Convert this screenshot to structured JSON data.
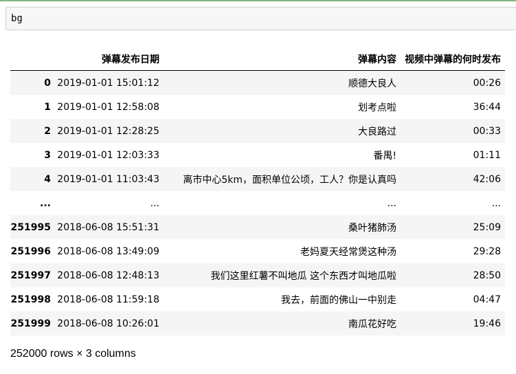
{
  "cell": {
    "code": "bg"
  },
  "table": {
    "columns": [
      "",
      "弹幕发布日期",
      "弹幕内容",
      "视频中弹幕的何时发布"
    ],
    "rows": [
      {
        "index": "0",
        "date": "2019-01-01 15:01:12",
        "content": "顺德大良人",
        "time": "00:26"
      },
      {
        "index": "1",
        "date": "2019-01-01 12:58:08",
        "content": "划考点啦",
        "time": "36:44"
      },
      {
        "index": "2",
        "date": "2019-01-01 12:28:25",
        "content": "大良路过",
        "time": "00:33"
      },
      {
        "index": "3",
        "date": "2019-01-01 12:03:33",
        "content": "番禺!",
        "time": "01:11"
      },
      {
        "index": "4",
        "date": "2019-01-01 11:03:43",
        "content": "离市中心5km，面积单位公顷，工人？你是认真吗",
        "time": "42:06"
      },
      {
        "index": "...",
        "date": "...",
        "content": "...",
        "time": "..."
      },
      {
        "index": "251995",
        "date": "2018-06-08 15:51:31",
        "content": "桑叶猪肺汤",
        "time": "25:09"
      },
      {
        "index": "251996",
        "date": "2018-06-08 13:49:09",
        "content": "老妈夏天经常煲这种汤",
        "time": "29:28"
      },
      {
        "index": "251997",
        "date": "2018-06-08 12:48:13",
        "content": "我们这里红薯不叫地瓜 这个东西才叫地瓜啦",
        "time": "28:50"
      },
      {
        "index": "251998",
        "date": "2018-06-08 11:59:18",
        "content": "我去，前面的佛山一中别走",
        "time": "04:47"
      },
      {
        "index": "251999",
        "date": "2018-06-08 10:26:01",
        "content": "南瓜花好吃",
        "time": "19:46"
      }
    ]
  },
  "shape": "252000 rows × 3 columns"
}
